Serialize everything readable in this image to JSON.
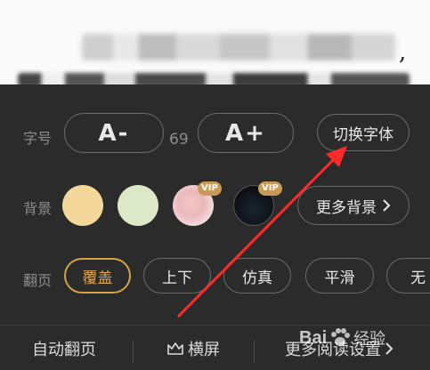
{
  "reader": {
    "trailing_punct": ","
  },
  "font_row": {
    "label": "字号",
    "decrease": "A-",
    "value": "69",
    "increase": "A+",
    "switch_font": "切换字体"
  },
  "bg_row": {
    "label": "背景",
    "swatches": [
      "#f4d89a",
      "#dde8c8",
      "pink-portrait",
      "dark-night"
    ],
    "vip_badge": "VIP",
    "more": "更多背景",
    "more_icon": "chevron-right-icon"
  },
  "page_row": {
    "label": "翻页",
    "modes": [
      "覆盖",
      "上下",
      "仿真",
      "平滑",
      "无"
    ],
    "active": "覆盖"
  },
  "bottom": {
    "auto_page": "自动翻页",
    "landscape": "横屏",
    "more_settings": "更多阅读设置",
    "landscape_icon": "crown-rotate-icon"
  },
  "watermark": {
    "text": "Bai",
    "text2": "经验"
  },
  "colors": {
    "panel_bg": "#2b2b2b",
    "accent": "#d6a24a",
    "arrow": "#ff2a2a"
  }
}
